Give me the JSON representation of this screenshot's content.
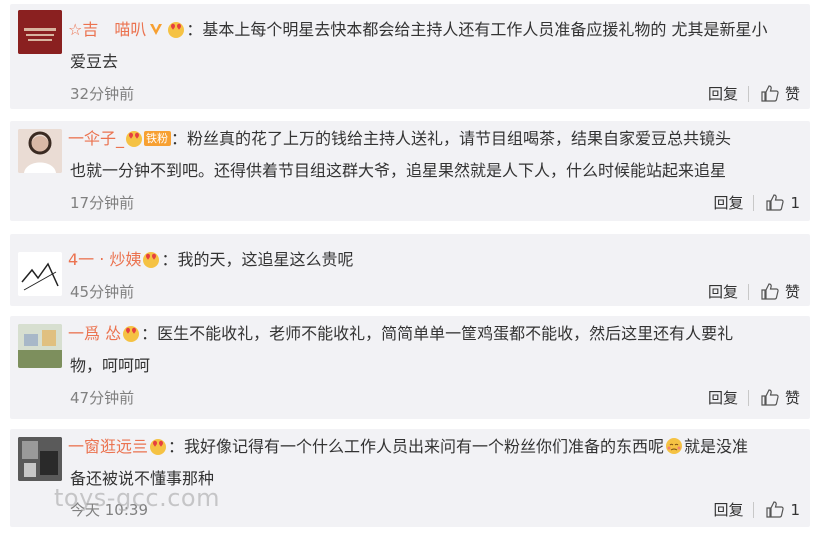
{
  "comments": [
    {
      "name": "☆吉　喵叭",
      "text_line1": "：基本上每个明星去快本都会给主持人还有工作人员准备应援礼物的 尤其是新星小",
      "text_line2": "爱豆去",
      "time": "32分钟前",
      "reply": "回复",
      "like": "赞"
    },
    {
      "name": "一伞子_",
      "fan_badge": "铁粉",
      "text_line1": "：粉丝真的花了上万的钱给主持人送礼，请节目组喝茶，结果自家爱豆总共镜头",
      "text_line2": "也就一分钟不到吧。还得供着节目组这群大爷，追星果然就是人下人，什么时候能站起来追星",
      "time": "17分钟前",
      "reply": "回复",
      "like": "1"
    },
    {
      "name": "4一 ‧ 炒姨",
      "text_line1": "：我的天，这追星这么贵呢",
      "time": "45分钟前",
      "reply": "回复",
      "like": "赞"
    },
    {
      "name": "一爲 怂",
      "text_line1": "：医生不能收礼，老师不能收礼，简简单单一筐鸡蛋都不能收，然后这里还有人要礼",
      "text_line2": "物，呵呵呵",
      "time": "47分钟前",
      "reply": "回复",
      "like": "赞"
    },
    {
      "name": "一窗逛远亖",
      "text_line1": "：我好像记得有一个什么工作人员出来问有一个粉丝你们准备的东西呢",
      "text_line1b": "就是没准",
      "text_line2": "备还被说不懂事那种",
      "time": "今天 10:39",
      "reply": "回复",
      "like": "1"
    }
  ],
  "watermark": "toys-gcc.com",
  "colors": {
    "card_bg": "#f2f2f5",
    "name": "#eb7350",
    "meta": "#808080",
    "verified": "#f7a032"
  },
  "icons": [
    "verified-v-icon",
    "heart-emoji-icon",
    "thumbs-up-icon",
    "shy-emoji-icon"
  ]
}
